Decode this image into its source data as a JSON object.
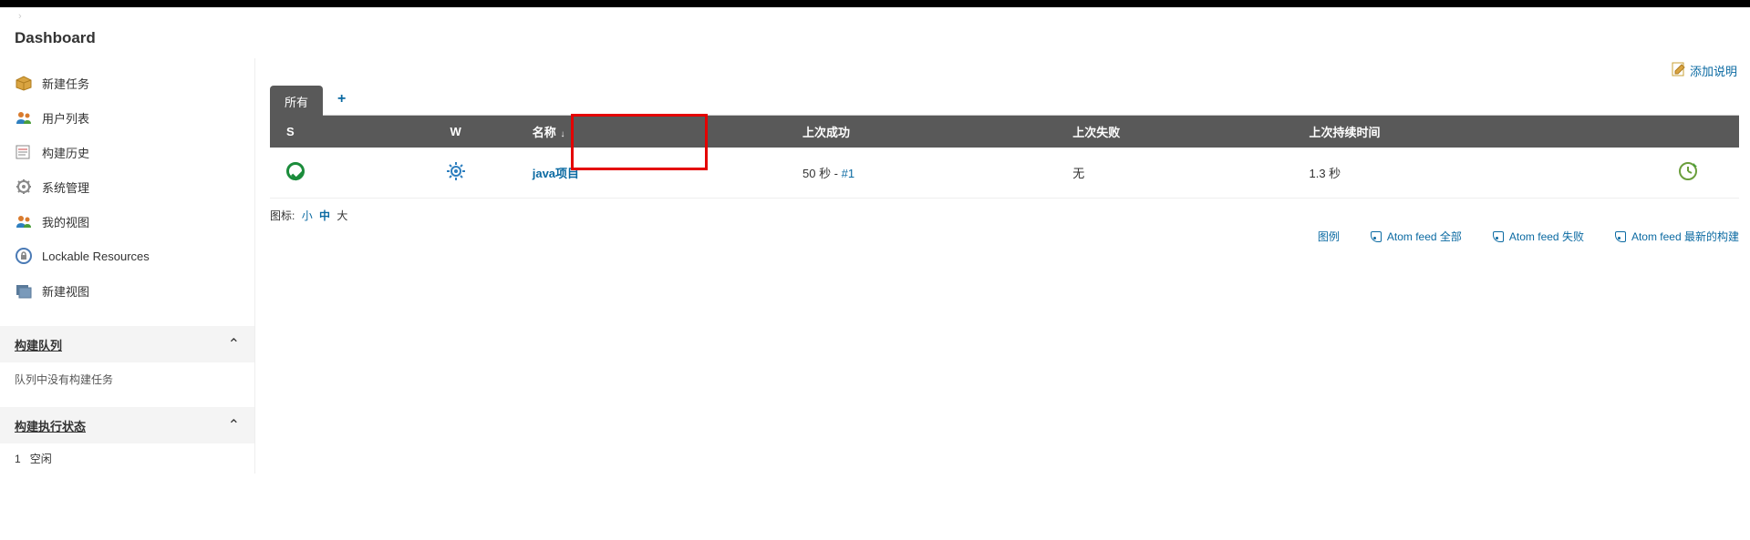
{
  "page_title": "Dashboard",
  "sidebar": {
    "items": [
      {
        "icon": "box-icon",
        "label": "新建任务"
      },
      {
        "icon": "users-icon",
        "label": "用户列表"
      },
      {
        "icon": "history-icon",
        "label": "构建历史"
      },
      {
        "icon": "gear-icon",
        "label": "系统管理"
      },
      {
        "icon": "users-icon",
        "label": "我的视图"
      },
      {
        "icon": "lock-icon",
        "label": "Lockable Resources"
      },
      {
        "icon": "newview-icon",
        "label": "新建视图"
      }
    ],
    "build_queue": {
      "title": "构建队列",
      "empty_text": "队列中没有构建任务"
    },
    "exec_status": {
      "title": "构建执行状态",
      "rows": [
        {
          "num": "1",
          "text": "空闲"
        }
      ]
    }
  },
  "main": {
    "add_desc_label": "添加说明",
    "tabs": {
      "active": "所有"
    },
    "columns": {
      "s": "S",
      "w": "W",
      "name": "名称",
      "last_success": "上次成功",
      "last_failure": "上次失败",
      "last_duration": "上次持续时间"
    },
    "rows": [
      {
        "name": "java项目",
        "last_success_text": "50 秒 - ",
        "last_success_build": "#1",
        "last_failure": "无",
        "last_duration": "1.3 秒"
      }
    ],
    "icon_legend": {
      "label": "图标:",
      "small": "小",
      "medium": "中",
      "large": "大"
    },
    "footer_links": {
      "legend": "图例",
      "atom_all": "Atom feed 全部",
      "atom_fail": "Atom feed 失败",
      "atom_latest": "Atom feed 最新的构建"
    }
  }
}
